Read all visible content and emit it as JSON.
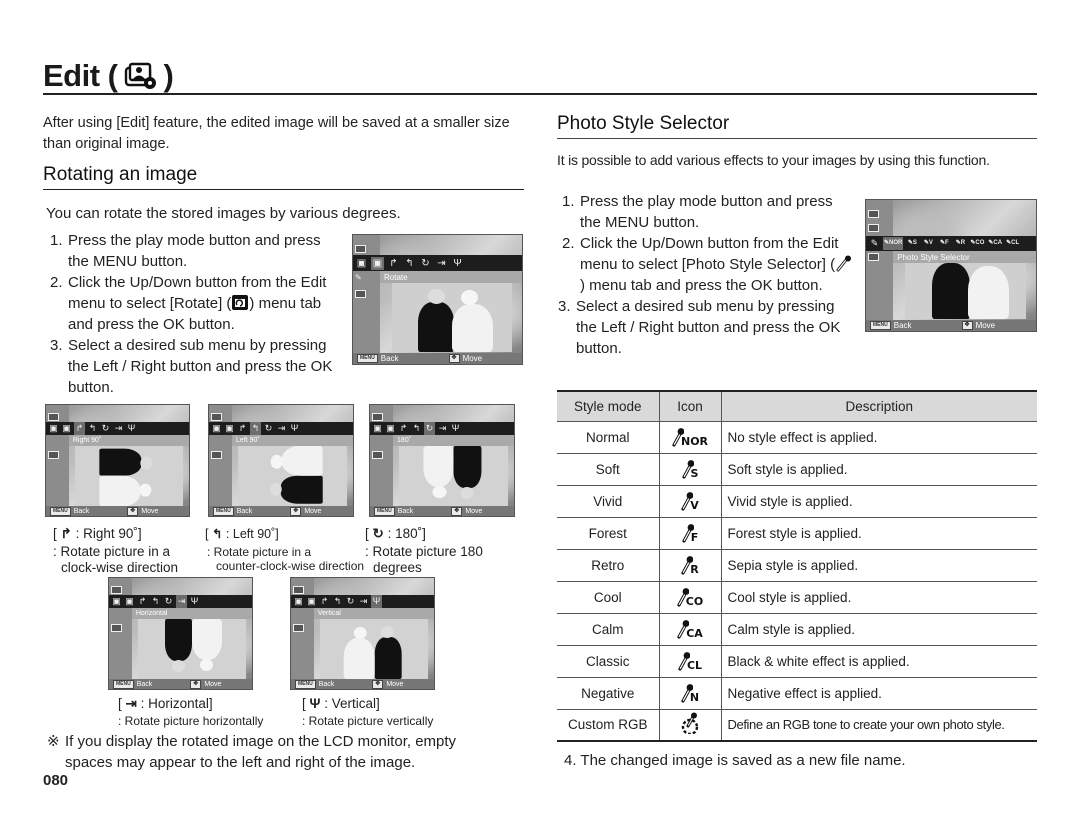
{
  "header": {
    "title": "Edit (",
    "title_close": ")",
    "title_icon": "edit-photo-gear-icon"
  },
  "left": {
    "intro": "After using [Edit] feature, the edited image will be saved at a smaller size than original image.",
    "section_title": "Rotating an image",
    "lead": "You can rotate the stored images by various degrees.",
    "steps": [
      {
        "num": "1.",
        "text": "Press the play mode button and press the MENU button."
      },
      {
        "num": "2.",
        "text_before": "Click the Up/Down button from the Edit menu to select [Rotate] (",
        "icon": "rotate-tab-icon",
        "text_after": ") menu tab and press the OK button."
      },
      {
        "num": "3.",
        "text": "Select a desired sub menu by pressing the Left / Right button and press the OK button."
      }
    ],
    "main_screen": {
      "selected_label": "Rotate",
      "back_label": "Back",
      "move_label": "Move",
      "menu_btn": "MENU"
    },
    "options": [
      {
        "icon": "rotate-right-icon",
        "glyph": "↱",
        "bracket_label": ": Right 90˚]",
        "desc_line1": ": Rotate picture in a",
        "desc_line2": "clock-wise direction",
        "screen_label": "Right 90˚"
      },
      {
        "icon": "rotate-left-icon",
        "glyph": "↰",
        "bracket_label": ":  Left 90˚]",
        "desc_line1": ":  Rotate picture in a",
        "desc_line2": "counter-clock-wise direction",
        "screen_label": "Left 90˚"
      },
      {
        "icon": "rotate-180-icon",
        "glyph": "↻",
        "bracket_label": ":  180˚]",
        "desc_line1": ": Rotate picture 180",
        "desc_line2": "degrees",
        "screen_label": "180˚"
      },
      {
        "icon": "flip-horizontal-icon",
        "glyph": "⇥",
        "bracket_label": ":  Horizontal]",
        "desc_line1": ": Rotate picture horizontally",
        "desc_line2": "",
        "screen_label": "Horizontal"
      },
      {
        "icon": "flip-vertical-icon",
        "glyph": "Ψ",
        "bracket_label": ":  Vertical]",
        "desc_line1": ": Rotate picture vertically",
        "desc_line2": "",
        "screen_label": "Vertical"
      }
    ],
    "note_symbol": "※",
    "note": "If you display the rotated image on the LCD monitor, empty spaces may appear to the left and right of the image.",
    "page_number": "080"
  },
  "right": {
    "section_title": "Photo Style Selector",
    "lead": "It is possible to add various effects to your images by using this function.",
    "steps": [
      {
        "num": "1.",
        "text": "Press the play mode button and press the MENU button."
      },
      {
        "num": "2.",
        "text_before": "Click the Up/Down button from the Edit menu to select [Photo Style Selector] (",
        "icon": "photo-style-selector-icon",
        "text_after": ") menu tab and press the OK button."
      },
      {
        "num": "3.",
        "text": "Select a desired sub menu by pressing the Left / Right button and press the OK button."
      }
    ],
    "screen": {
      "selected_label": "Photo Style Selector",
      "back_label": "Back",
      "move_label": "Move",
      "menu_btn": "MENU",
      "tab_codes": [
        "NOR",
        "S",
        "V",
        "F",
        "R",
        "CO",
        "CA",
        "CL"
      ]
    },
    "table": {
      "headers": [
        "Style mode",
        "Icon",
        "Description"
      ],
      "rows": [
        {
          "mode": "Normal",
          "icon": "style-normal-icon",
          "code": "NOR",
          "desc": "No style effect is applied."
        },
        {
          "mode": "Soft",
          "icon": "style-soft-icon",
          "code": "S",
          "desc": "Soft style is applied."
        },
        {
          "mode": "Vivid",
          "icon": "style-vivid-icon",
          "code": "V",
          "desc": "Vivid style is applied."
        },
        {
          "mode": "Forest",
          "icon": "style-forest-icon",
          "code": "F",
          "desc": "Forest style is applied."
        },
        {
          "mode": "Retro",
          "icon": "style-retro-icon",
          "code": "R",
          "desc": "Sepia style is applied."
        },
        {
          "mode": "Cool",
          "icon": "style-cool-icon",
          "code": "CO",
          "desc": "Cool style is applied."
        },
        {
          "mode": "Calm",
          "icon": "style-calm-icon",
          "code": "CA",
          "desc": "Calm style is applied."
        },
        {
          "mode": "Classic",
          "icon": "style-classic-icon",
          "code": "CL",
          "desc": "Black & white effect is applied."
        },
        {
          "mode": "Negative",
          "icon": "style-negative-icon",
          "code": "N",
          "desc": "Negative effect is applied."
        },
        {
          "mode": "Custom RGB",
          "icon": "style-custom-rgb-icon",
          "code": "",
          "desc": "Define an RGB tone to create your own photo style."
        }
      ]
    },
    "final_step": "4. The changed image is saved as a new file name."
  }
}
